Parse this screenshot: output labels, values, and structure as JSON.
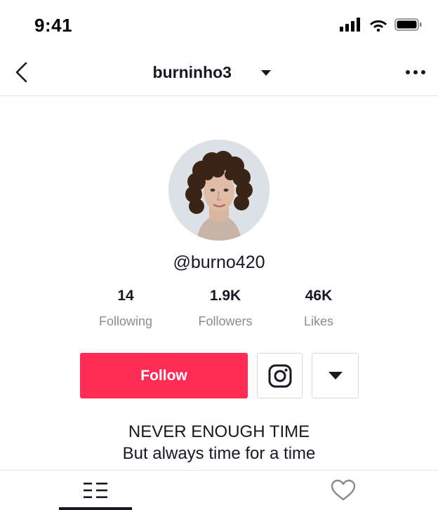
{
  "status_bar": {
    "time": "9:41",
    "icons": [
      "signal-icon",
      "wifi-icon",
      "battery-icon"
    ]
  },
  "header": {
    "username": "burninho3",
    "back_icon": "chevron-left-icon",
    "dropdown_icon": "caret-down-icon",
    "more_icon": "more-icon"
  },
  "profile": {
    "handle": "@burno420",
    "stats": [
      {
        "value": "14",
        "label": "Following"
      },
      {
        "value": "1.9K",
        "label": "Followers"
      },
      {
        "value": "46K",
        "label": "Likes"
      }
    ],
    "follow_label": "Follow",
    "bio_lines": [
      "NEVER ENOUGH TIME",
      "But always time for a time"
    ]
  },
  "tabs": [
    {
      "name": "videos",
      "icon": "list-icon",
      "active": true
    },
    {
      "name": "liked",
      "icon": "heart-icon",
      "active": false
    }
  ],
  "colors": {
    "accent": "#fe2c55",
    "text": "#161823",
    "muted": "#8a8b91",
    "border": "#e3e3e4"
  }
}
